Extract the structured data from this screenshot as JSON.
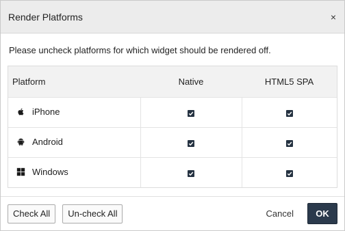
{
  "dialog": {
    "title": "Render Platforms",
    "close_label": "×",
    "instructions": "Please uncheck platforms for which widget should be rendered off."
  },
  "table": {
    "headers": [
      "Platform",
      "Native",
      "HTML5 SPA"
    ],
    "rows": [
      {
        "platform": "iPhone",
        "icon": "apple-icon",
        "native": true,
        "html5_spa": true
      },
      {
        "platform": "Android",
        "icon": "android-icon",
        "native": true,
        "html5_spa": true
      },
      {
        "platform": "Windows",
        "icon": "windows-icon",
        "native": true,
        "html5_spa": true
      }
    ]
  },
  "footer": {
    "check_all": "Check All",
    "uncheck_all": "Un-check All",
    "cancel": "Cancel",
    "ok": "OK"
  },
  "colors": {
    "header_bg": "#ececec",
    "table_header_bg": "#f2f2f2",
    "checkbox": "#253241",
    "primary_button": "#2b3a4c"
  }
}
